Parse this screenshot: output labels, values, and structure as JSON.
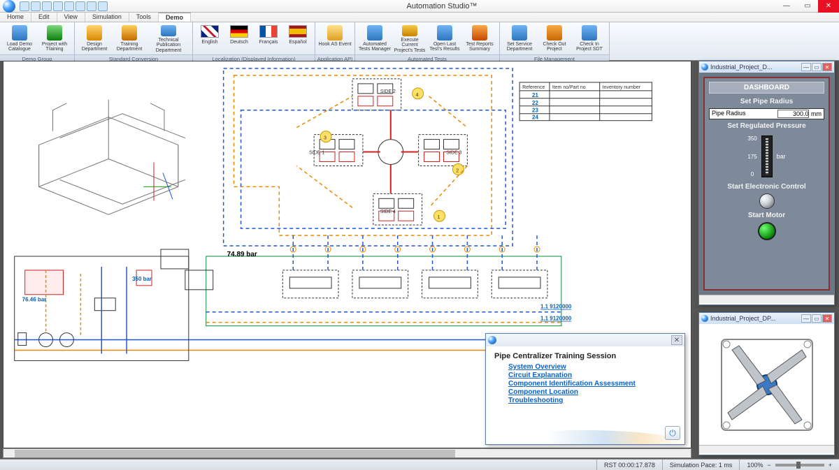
{
  "app": {
    "title": "Automation Studio™"
  },
  "menu": {
    "items": [
      "Home",
      "Edit",
      "View",
      "Simulation",
      "Tools",
      "Demo"
    ],
    "active": "Demo"
  },
  "ribbon": {
    "groups": [
      {
        "label": "Demo Group",
        "buttons": [
          {
            "label": "Load Demo Catalogue"
          },
          {
            "label": "Project with Training"
          }
        ]
      },
      {
        "label": "Standard Conversion",
        "buttons": [
          {
            "label": "Design Department"
          },
          {
            "label": "Training Department"
          },
          {
            "label": "Technical Publication Department"
          }
        ]
      },
      {
        "label": "Localization (Displayed Information)",
        "buttons": [
          {
            "label": "English"
          },
          {
            "label": "Deutsch"
          },
          {
            "label": "Français"
          },
          {
            "label": "Español"
          }
        ]
      },
      {
        "label": "Application API",
        "buttons": [
          {
            "label": "Hook AS Event"
          }
        ]
      },
      {
        "label": "Automated Tests",
        "buttons": [
          {
            "label": "Automated Tests Manager"
          },
          {
            "label": "Execute Current Project's Tests"
          },
          {
            "label": "Open Last Test's Results"
          },
          {
            "label": "Test Reports Summary"
          }
        ]
      },
      {
        "label": "File Management",
        "buttons": [
          {
            "label": "Set Service Department"
          },
          {
            "label": "Check Out Project"
          },
          {
            "label": "Check In Project SDT"
          }
        ]
      }
    ]
  },
  "schematic": {
    "sides": [
      "SIDE 1",
      "SIDE 2",
      "SIDE 3",
      "SIDE 4"
    ],
    "callouts": [
      "1",
      "2",
      "3",
      "4"
    ],
    "pressures": {
      "p1": "76.46 bar",
      "p2": "350 bar",
      "p3": "74.89 bar"
    },
    "table": {
      "headers": [
        "Reference",
        "Item no/Part no",
        "Inventory number"
      ],
      "rows": [
        [
          "21",
          "",
          ""
        ],
        [
          "22",
          "",
          ""
        ],
        [
          "23",
          "",
          ""
        ],
        [
          "24",
          "",
          ""
        ]
      ]
    }
  },
  "dashboard": {
    "panel_title": "Industrial_Project_D...",
    "title": "DASHBOARD",
    "set_radius": "Set Pipe Radius",
    "radius_label": "Pipe Radius",
    "radius_value": "300.0",
    "radius_unit": "mm",
    "set_pressure": "Set Regulated Pressure",
    "scale": [
      "350",
      "175",
      "0"
    ],
    "unit": "bar",
    "start_ec": "Start Electronic Control",
    "start_motor": "Start Motor"
  },
  "plan": {
    "panel_title": "Industrial_Project_DP..."
  },
  "training": {
    "title": "Pipe Centralizer Training Session",
    "links": [
      "System Overview",
      "Circuit Explanation",
      "Component Identification Assessment",
      "Component Location",
      "Troubleshooting"
    ]
  },
  "status": {
    "rst": "RST 00:00:17.878",
    "pace": "Simulation Pace: 1 ms",
    "zoom": "100%"
  }
}
